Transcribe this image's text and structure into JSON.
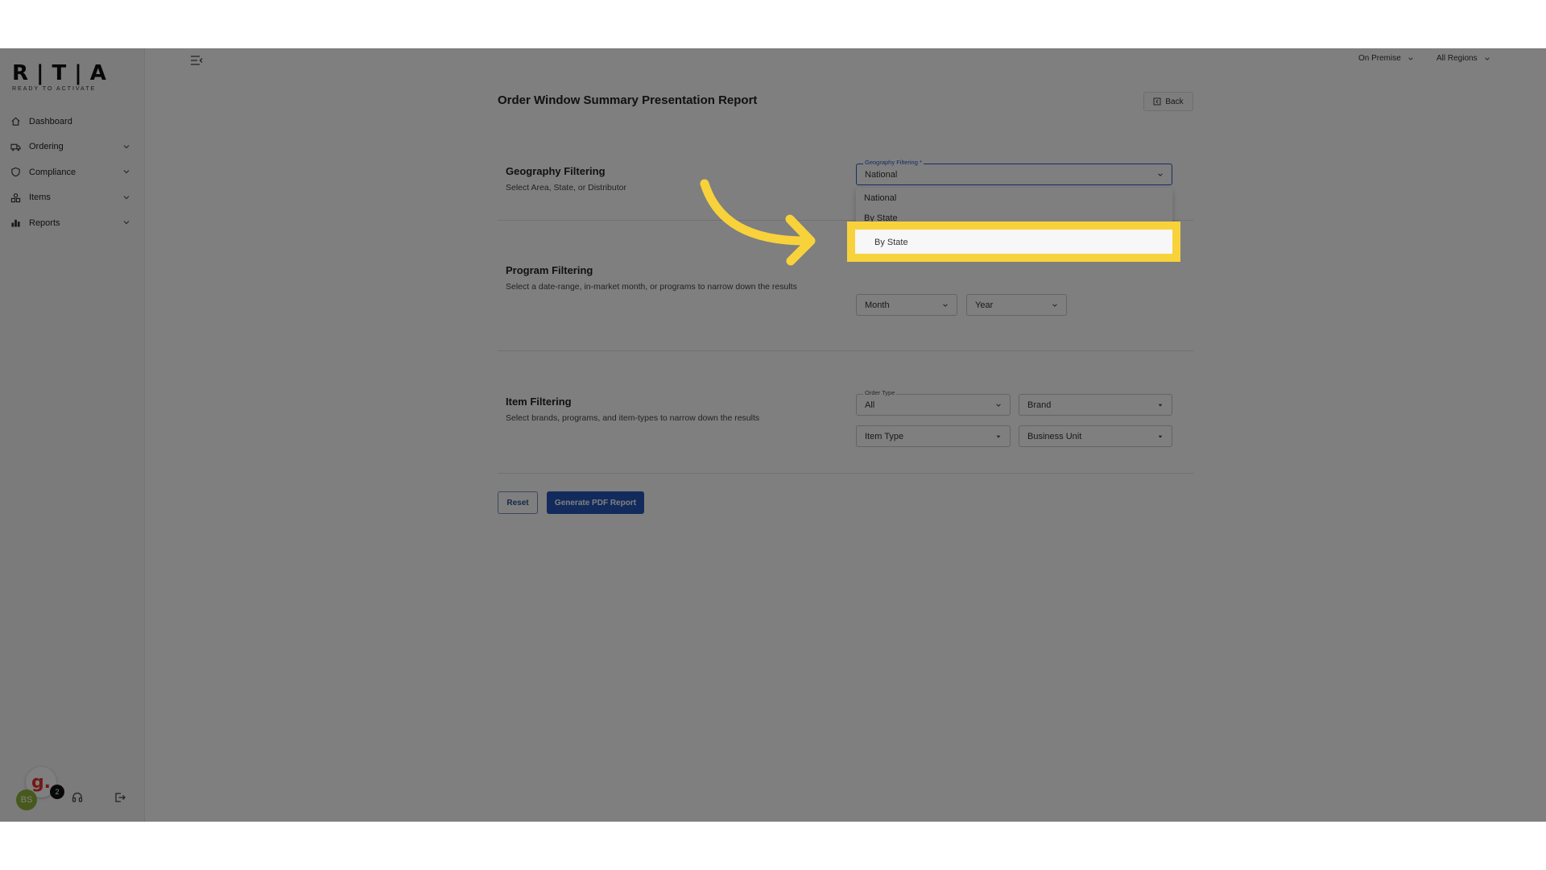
{
  "brand": {
    "logo": "R|T|A",
    "tagline": "READY TO ACTIVATE"
  },
  "sidebar": {
    "items": [
      {
        "label": "Dashboard",
        "icon": "home-icon",
        "expandable": false
      },
      {
        "label": "Ordering",
        "icon": "truck-icon",
        "expandable": true
      },
      {
        "label": "Compliance",
        "icon": "shield-icon",
        "expandable": true
      },
      {
        "label": "Items",
        "icon": "items-icon",
        "expandable": true
      },
      {
        "label": "Reports",
        "icon": "chart-icon",
        "expandable": true
      }
    ],
    "user_initials": "BS",
    "notification_count": "2",
    "guide_badge": "g."
  },
  "topbar": {
    "channel": "On Premise",
    "region": "All Regions"
  },
  "page": {
    "title": "Order Window Summary Presentation Report",
    "back_label": "Back"
  },
  "geography": {
    "title": "Geography Filtering",
    "description": "Select Area, State, or Distributor",
    "field_label": "Geography Filtering *",
    "value": "National",
    "options": [
      "National",
      "By State"
    ]
  },
  "program": {
    "title": "Program Filtering",
    "description": "Select a date-range, in-market month, or programs to narrow down the results",
    "month_placeholder": "Month",
    "year_placeholder": "Year"
  },
  "item_filtering": {
    "title": "Item Filtering",
    "description": "Select brands, programs, and item-types to narrow down the results",
    "order_type_label": "Order Type",
    "order_type_value": "All",
    "brand_placeholder": "Brand",
    "item_type_placeholder": "Item Type",
    "business_unit_placeholder": "Business Unit"
  },
  "actions": {
    "reset": "Reset",
    "generate": "Generate PDF Report"
  },
  "highlight": {
    "label": "By State",
    "color": "#f8d23b"
  },
  "colors": {
    "primary": "#2457b9",
    "highlight": "#f8d23b"
  }
}
